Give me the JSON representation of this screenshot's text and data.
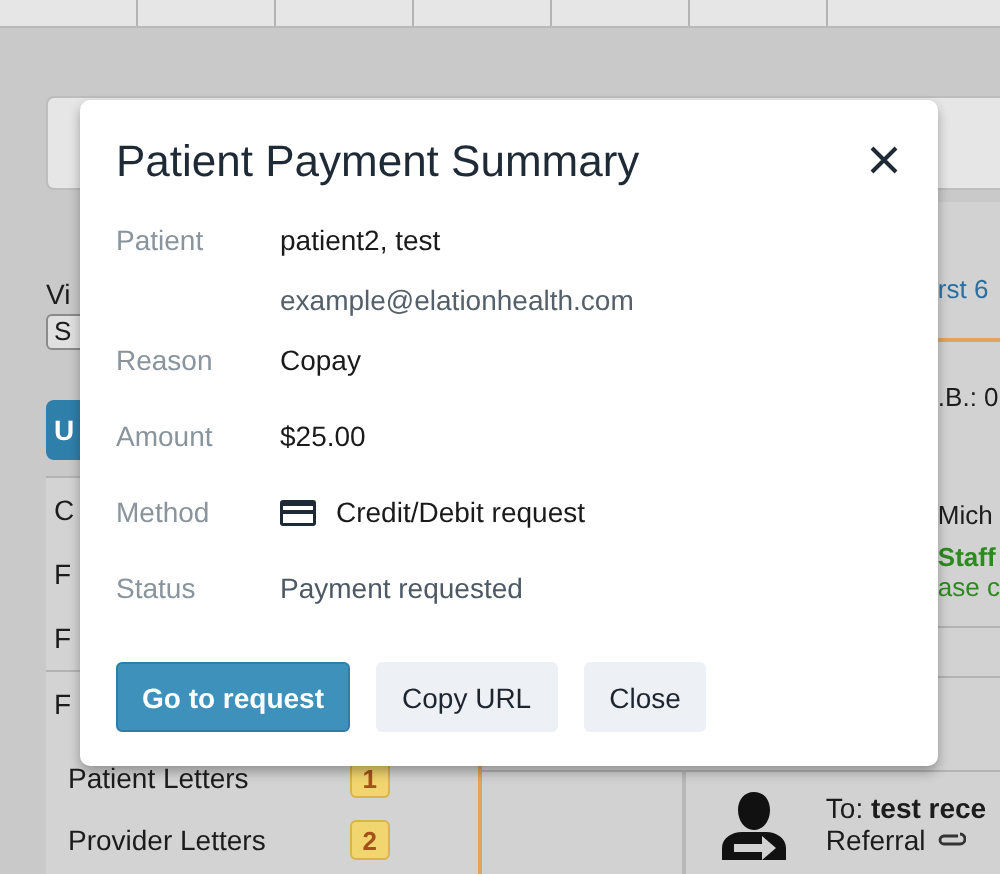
{
  "left_panel": {
    "label": "Vi",
    "select_value": "S",
    "button": "U",
    "items": [
      "C",
      "F",
      "F",
      "F"
    ],
    "letters": [
      {
        "label": "Patient Letters",
        "count": "1"
      },
      {
        "label": "Provider Letters",
        "count": "2"
      }
    ]
  },
  "right_panel": {
    "link": "rst 6",
    "dob": ".B.: 0",
    "name": "Mich",
    "staff": "Staff",
    "note": "ase c"
  },
  "message": {
    "to": "To: **test rece**",
    "type": "Referral"
  },
  "modal": {
    "title": "Patient Payment Summary",
    "rows": [
      {
        "label": "Patient",
        "value": "patient2, test",
        "detail": "example@elationhealth.com",
        "kind": "text"
      },
      {
        "label": "Reason",
        "value": "Copay",
        "kind": "text"
      },
      {
        "label": "Amount",
        "value": "$25.00",
        "kind": "text"
      },
      {
        "label": "Method",
        "value": "Credit/Debit request",
        "kind": "card"
      },
      {
        "label": "Status",
        "value": "Payment requested",
        "kind": "status"
      }
    ],
    "buttons": [
      {
        "label": "Go to request",
        "primary": true
      },
      {
        "label": "Copy URL",
        "primary": false
      },
      {
        "label": "Close",
        "primary": false
      }
    ]
  }
}
